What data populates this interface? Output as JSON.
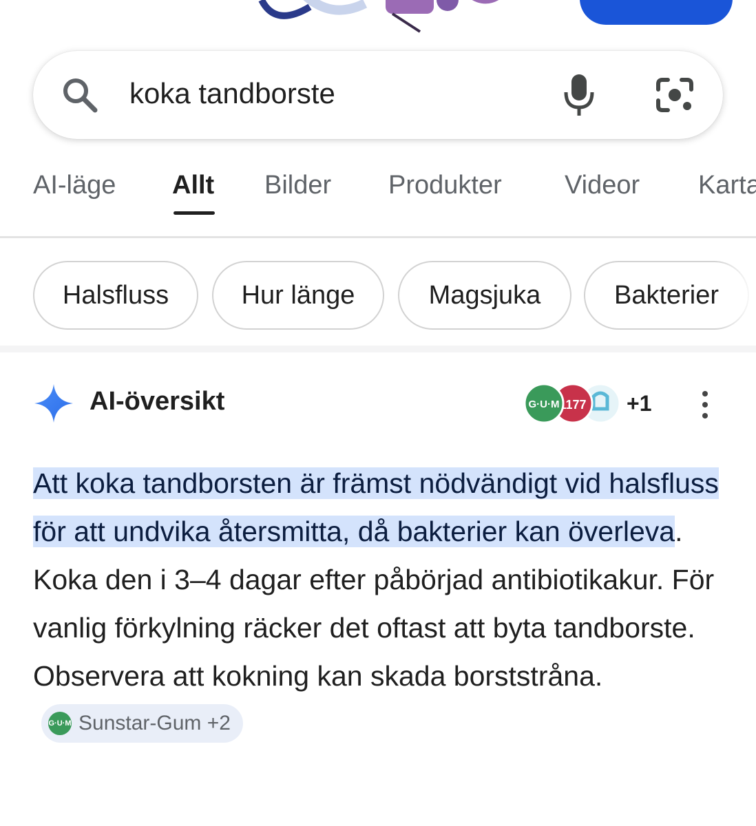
{
  "search": {
    "query": "koka tandborste"
  },
  "tabs": [
    {
      "label": "AI-läge"
    },
    {
      "label": "Allt"
    },
    {
      "label": "Bilder"
    },
    {
      "label": "Produkter"
    },
    {
      "label": "Videor"
    },
    {
      "label": "Karta"
    }
  ],
  "chips": [
    {
      "label": "Halsfluss"
    },
    {
      "label": "Hur länge"
    },
    {
      "label": "Magsjuka"
    },
    {
      "label": "Bakterier"
    }
  ],
  "ai_overview": {
    "title": "AI-översikt",
    "sources_more": "+1",
    "source_logos": [
      "G·U·M",
      "1177"
    ],
    "highlight_text": "Att koka tandborsten är främst nödvändigt vid halsfluss för att undvika återsmitta, då bakterier kan överleva",
    "body_text": ". Koka den i 3–4 dagar efter påbörjad antibiotikakur. För vanlig förkylning räcker det oftast att byta tandborste. Observera att kokning kan skada borststråna.",
    "citation": {
      "logo": "G·U·M",
      "label": "Sunstar-Gum +2"
    }
  },
  "colors": {
    "accent_blue": "#1a55d8",
    "highlight_bg": "#d4e3fc",
    "citation_bg": "#e9eef8"
  }
}
